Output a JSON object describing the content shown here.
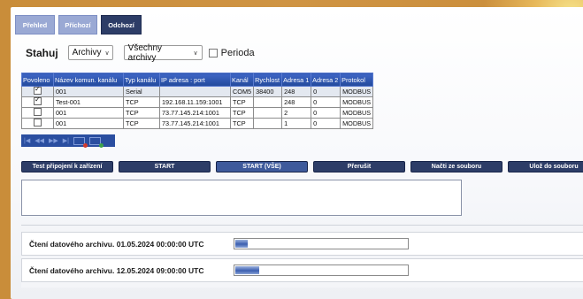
{
  "tabs": [
    {
      "label": "Přehled",
      "active": false
    },
    {
      "label": "Příchozí",
      "active": false
    },
    {
      "label": "Odchozí",
      "active": true
    }
  ],
  "download": {
    "label": "Stahuj",
    "type_select": "Archivy",
    "scope_select": "Všechny archivy",
    "period_checkbox_label": "Perioda",
    "period_checked": false
  },
  "table": {
    "columns": [
      "Povoleno",
      "Název komun. kanálu",
      "Typ kanálu",
      "IP adresa : port",
      "Kanál",
      "Rychlost",
      "Adresa 1",
      "Adresa 2",
      "Protokol"
    ],
    "rows": [
      {
        "enabled": true,
        "name": "001",
        "type": "Serial",
        "ip": "",
        "channel": "COM5",
        "speed": "38400",
        "addr1": "248",
        "addr2": "0",
        "protocol": "MODBUS",
        "selected": true
      },
      {
        "enabled": true,
        "name": "Test-001",
        "type": "TCP",
        "ip": "192.168.11.159:1001",
        "channel": "TCP",
        "speed": "",
        "addr1": "248",
        "addr2": "0",
        "protocol": "MODBUS",
        "selected": false
      },
      {
        "enabled": false,
        "name": "001",
        "type": "TCP",
        "ip": "73.77.145.214:1001",
        "channel": "TCP",
        "speed": "",
        "addr1": "2",
        "addr2": "0",
        "protocol": "MODBUS",
        "selected": false
      },
      {
        "enabled": false,
        "name": "001",
        "type": "TCP",
        "ip": "73.77.145.214:1001",
        "channel": "TCP",
        "speed": "",
        "addr1": "1",
        "addr2": "0",
        "protocol": "MODBUS",
        "selected": false
      }
    ]
  },
  "pager_icons": [
    "first-icon",
    "prev-icon",
    "next-icon",
    "last-icon",
    "delete-row-icon",
    "add-row-icon"
  ],
  "actions": {
    "test": "Test připojení k zařízení",
    "start": "START",
    "start_all": "START (VŠE)",
    "stop": "Přerušit",
    "load": "Načti ze souboru",
    "save": "Ulož do souboru"
  },
  "progress": [
    {
      "label": "Čtení datového archivu. 01.05.2024 00:00:00 UTC",
      "fraction": 0.07
    },
    {
      "label": "Čtení datového archivu. 12.05.2024 09:00:00 UTC",
      "fraction": 0.14
    }
  ],
  "colors": {
    "accent": "#2d3d67",
    "header_blue": "#234a9c",
    "inactive_tab": "#9aa9d4"
  }
}
